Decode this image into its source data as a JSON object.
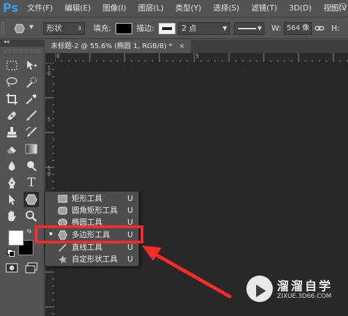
{
  "app": {
    "logo_text": "Ps"
  },
  "menu": {
    "items": [
      "文件(F)",
      "编辑(E)",
      "图像(I)",
      "图层(L)",
      "类型(Y)",
      "选择(S)",
      "滤镜(T)",
      "3D(D)",
      "视图(V)"
    ],
    "window_controls": [
      "–",
      "□"
    ]
  },
  "options_bar": {
    "mode": "形状",
    "fill_label": "填充:",
    "fill_color": "#000000",
    "stroke_label": "描边:",
    "stroke_color": "#ffffff",
    "stroke_width": "2 点",
    "w_label": "W:",
    "w_value": "564 像",
    "h_label": "H:"
  },
  "document": {
    "tab_title": "未标题-2 @ 55.6% (椭圆 1, RGB/8) *",
    "close_glyph": "×"
  },
  "rulers": {
    "top_labels": [
      "0",
      "5"
    ],
    "left_labels": [
      "1",
      "0",
      "5",
      "1",
      "0",
      "1",
      "5"
    ]
  },
  "toolbox": {
    "collapse_glyph": "◂◂",
    "swap_glyph": "⇆",
    "text_tool_glyph": "T",
    "fg_color": "#ffffff",
    "bg_color": "#000000"
  },
  "flyout": {
    "items": [
      {
        "label": "矩形工具",
        "key": "U",
        "icon": "rectangle-icon",
        "selected": false
      },
      {
        "label": "圆角矩形工具",
        "key": "U",
        "icon": "rounded-rectangle-icon",
        "selected": false
      },
      {
        "label": "椭圆工具",
        "key": "U",
        "icon": "ellipse-icon",
        "selected": false
      },
      {
        "label": "多边形工具",
        "key": "U",
        "icon": "polygon-icon",
        "selected": true
      },
      {
        "label": "直线工具",
        "key": "U",
        "icon": "line-icon",
        "selected": false
      },
      {
        "label": "自定形状工具",
        "key": "U",
        "icon": "custom-shape-icon",
        "selected": false
      }
    ]
  },
  "annotation": {
    "color": "#ff2a2a"
  },
  "watermark": {
    "title": "溜溜自学",
    "url": "ZIXUE.3D66.COM"
  }
}
